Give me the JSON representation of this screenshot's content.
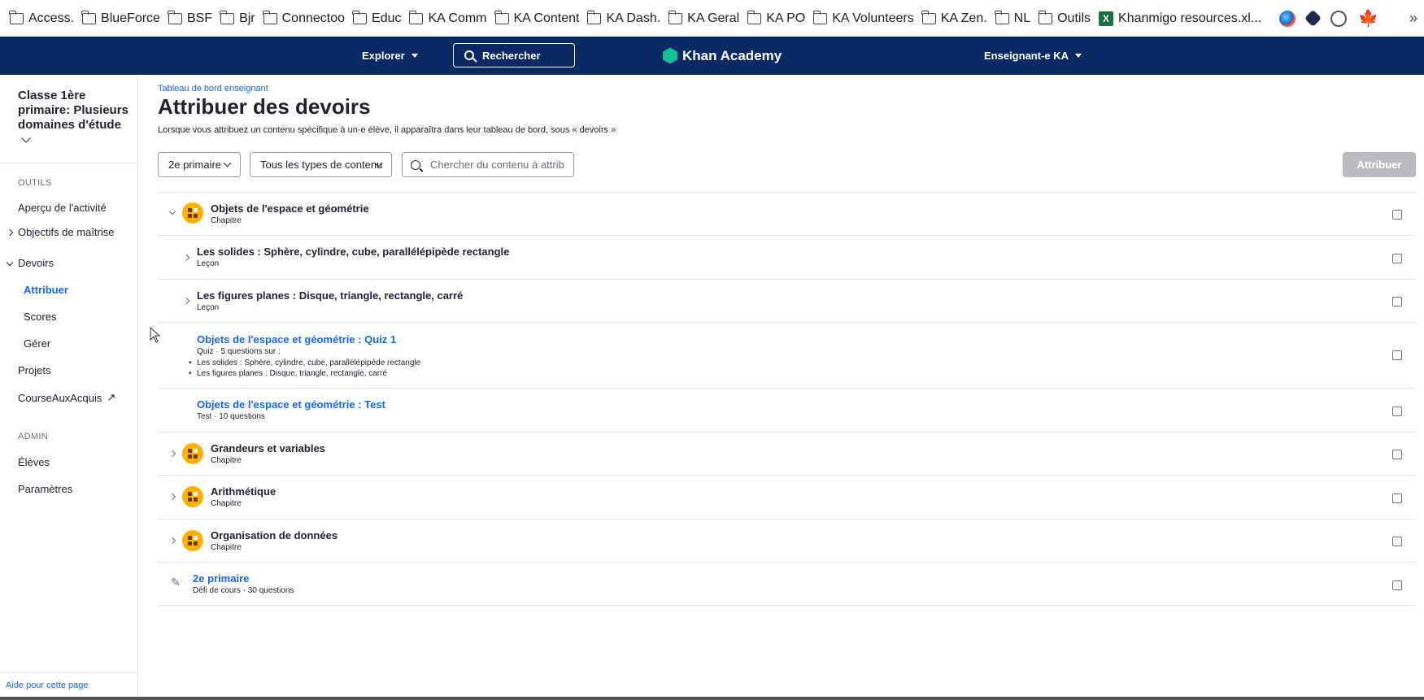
{
  "bookmarks": [
    {
      "label": "Access.",
      "icon": "folder-icon"
    },
    {
      "label": "BlueForce",
      "icon": "folder-icon"
    },
    {
      "label": "BSF",
      "icon": "folder-icon"
    },
    {
      "label": "Bjr",
      "icon": "folder-icon"
    },
    {
      "label": "Connectoo",
      "icon": "folder-icon"
    },
    {
      "label": "Educ",
      "icon": "folder-icon"
    },
    {
      "label": "KA Comm",
      "icon": "folder-icon"
    },
    {
      "label": "KA Content",
      "icon": "folder-icon"
    },
    {
      "label": "KA Dash.",
      "icon": "folder-icon"
    },
    {
      "label": "KA Geral",
      "icon": "folder-icon"
    },
    {
      "label": "KA PO",
      "icon": "folder-icon"
    },
    {
      "label": "KA Volunteers",
      "icon": "folder-icon"
    },
    {
      "label": "KA Zen.",
      "icon": "folder-icon"
    },
    {
      "label": "NL",
      "icon": "folder-icon"
    },
    {
      "label": "Outils",
      "icon": "folder-icon"
    },
    {
      "label": "Khanmigo resources.xl...",
      "icon": "excel-icon"
    }
  ],
  "topnav": {
    "explore_label": "Explorer",
    "search_label": "Rechercher",
    "logo_text": "Khan Academy",
    "user_label": "Enseignant-e KA",
    "bg_color": "#0a2a66"
  },
  "sidebar": {
    "class_title": "Classe 1ère primaire: Plusieurs domaines d'étude",
    "tools_heading": "OUTILS",
    "items": {
      "activity": "Aperçu de l'activité",
      "mastery": "Objectifs de maîtrise",
      "assignments": "Devoirs",
      "assign": "Attribuer",
      "scores": "Scores",
      "manage": "Gérer",
      "projects": "Projets",
      "course_challenge": "CourseAuxAcquis"
    },
    "admin_heading": "ADMIN",
    "admin_items": {
      "students": "Élèves",
      "settings": "Paramètres"
    },
    "help": "Aide pour cette page"
  },
  "main": {
    "breadcrumb": "Tableau de bord enseignant",
    "title": "Attribuer des devoirs",
    "subtitle": "Lorsque vous attribuez un contenu spécifique à un·e élève, il apparaîtra dans leur tableau de bord, sous « devoirs »",
    "grade_select": "2e primaire",
    "type_select": "Tous les types de contenu",
    "search_placeholder": "Chercher du contenu à attrib",
    "assign_button": "Attribuer",
    "accent_color": "#1865f2"
  },
  "rows": [
    {
      "title": "Objets de l'espace et géométrie",
      "sub": "Chapitre"
    },
    {
      "title": "Les solides : Sphère, cylindre, cube, parallélépipède rectangle",
      "sub": "Leçon"
    },
    {
      "title": "Les figures planes : Disque, triangle, rectangle, carré",
      "sub": "Leçon"
    },
    {
      "title": "Objets de l'espace et géométrie : Quiz 1",
      "sub": "Quiz · 5 questions sur :",
      "bullets": [
        "Les solides : Sphère, cylindre, cube, parallélépipède rectangle",
        "Les figures planes : Disque, triangle, rectangle, carré"
      ]
    },
    {
      "title": "Objets de l'espace et géométrie : Test",
      "sub": "Test · 10 questions"
    },
    {
      "title": "Grandeurs et variables",
      "sub": "Chapitre"
    },
    {
      "title": "Arithmétique",
      "sub": "Chapitre"
    },
    {
      "title": "Organisation de données",
      "sub": "Chapitre"
    },
    {
      "title": "2e primaire",
      "sub": "Défi de cours · 30 questions"
    }
  ]
}
